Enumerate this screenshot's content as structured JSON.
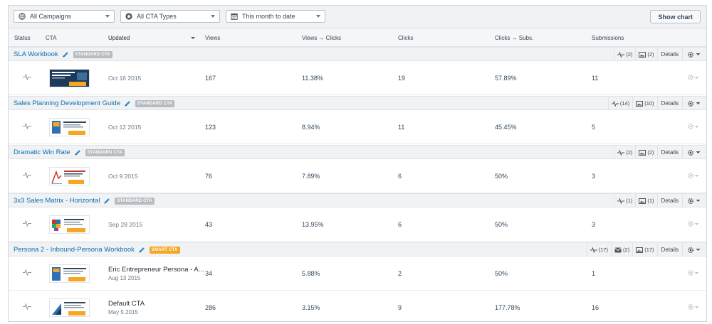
{
  "toolbar": {
    "campaigns": "All Campaigns",
    "cta_types": "All CTA Types",
    "date_range": "This month to date",
    "show_chart": "Show chart"
  },
  "columns": {
    "status": "Status",
    "cta": "CTA",
    "updated": "Updated",
    "views": "Views",
    "views_clicks": "Views → Clicks",
    "clicks": "Clicks",
    "clicks_subs": "Clicks → Subs.",
    "submissions": "Submissions"
  },
  "groups": [
    {
      "title": "SLA Workbook",
      "badge": "STANDARD CTA",
      "tests": "(2)",
      "variants": "(2)",
      "details": "Details",
      "rows": [
        {
          "updated": "Oct 16 2015",
          "views": "167",
          "views_clicks": "11.38%",
          "clicks": "19",
          "clicks_subs": "57.89%",
          "submissions": "11"
        }
      ]
    },
    {
      "title": "Sales Planning Development Guide",
      "badge": "STANDARD CTA",
      "tests": "(14)",
      "variants": "(10)",
      "details": "Details",
      "rows": [
        {
          "updated": "Oct 12 2015",
          "views": "123",
          "views_clicks": "8.94%",
          "clicks": "11",
          "clicks_subs": "45.45%",
          "submissions": "5"
        }
      ]
    },
    {
      "title": "Dramatic Win Rate",
      "badge": "STANDARD CTA",
      "tests": "(2)",
      "variants": "(2)",
      "details": "Details",
      "rows": [
        {
          "updated": "Oct 9 2015",
          "views": "76",
          "views_clicks": "7.89%",
          "clicks": "6",
          "clicks_subs": "50%",
          "submissions": "3"
        }
      ]
    },
    {
      "title": "3x3 Sales Matrix - Horizontal",
      "badge": "STANDARD CTA",
      "tests": "(1)",
      "variants": "(1)",
      "details": "Details",
      "rows": [
        {
          "updated": "Sep 28 2015",
          "views": "43",
          "views_clicks": "13.95%",
          "clicks": "6",
          "clicks_subs": "50%",
          "submissions": "3"
        }
      ]
    },
    {
      "title": "Persona 2 - Inbound-Persona Workbook",
      "badge": "SMART CTA",
      "tests": "(17)",
      "smart_rules": "(2)",
      "variants": "(17)",
      "details": "Details",
      "rows": [
        {
          "name": "Eric Entrepreneur Persona - A...",
          "updated": "Aug 13 2015",
          "views": "34",
          "views_clicks": "5.88%",
          "clicks": "2",
          "clicks_subs": "50%",
          "submissions": "1"
        },
        {
          "name": "Default CTA",
          "updated": "May 5 2015",
          "views": "286",
          "views_clicks": "3.15%",
          "clicks": "9",
          "clicks_subs": "177.78%",
          "submissions": "16"
        }
      ]
    }
  ],
  "colors": {
    "link": "#0a6fb5",
    "standard_badge": "#b7bcc2",
    "smart_badge": "#f5a623",
    "header_bg": "#f1f2f3"
  },
  "icons": [
    "globe-icon",
    "star-badge-icon",
    "calendar-icon",
    "pencil-icon",
    "pulse-icon",
    "image-icon",
    "envelope-icon",
    "gear-icon",
    "chevron-down-icon"
  ]
}
